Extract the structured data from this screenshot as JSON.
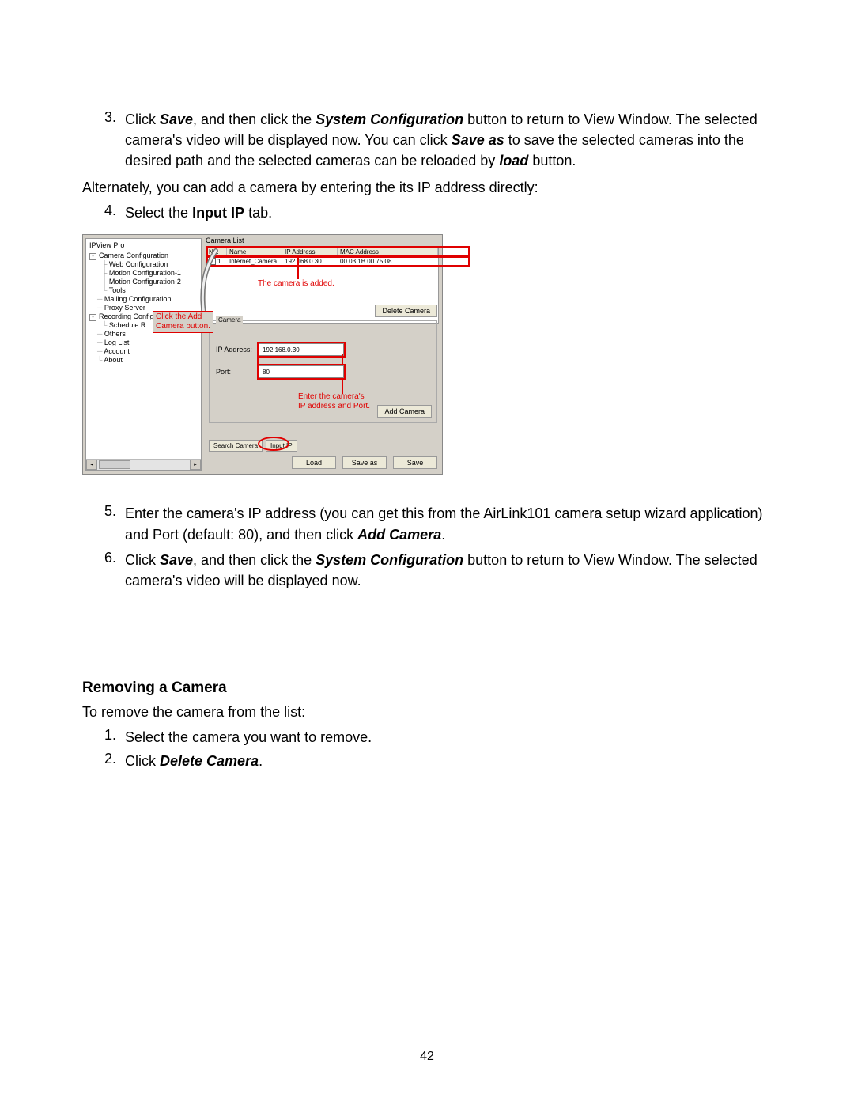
{
  "step3": {
    "num": "3.",
    "t1": "Click ",
    "save": "Save",
    "t2": ", and then click the ",
    "sysconf": "System Configuration",
    "t3": " button to return to View Window. The selected camera's video will be displayed now. You can click ",
    "saveas": "Save as",
    "t4": " to save the selected cameras into the desired path and the selected cameras can be reloaded by ",
    "load": "load",
    "t5": " button."
  },
  "alt_text": "Alternately, you can add a camera by entering the its IP address directly:",
  "step4": {
    "num": "4.",
    "t1": "Select the ",
    "inputip": "Input IP",
    "t2": " tab."
  },
  "app": {
    "title": "IPView Pro",
    "tree": {
      "cam_config": "Camera Configuration",
      "web_config": "Web Configuration",
      "motion1": "Motion Configuration-1",
      "motion2": "Motion Configuration-2",
      "tools": "Tools",
      "mailing": "Mailing Configuration",
      "proxy": "Proxy Server",
      "rec_config": "Recording Configuration",
      "schedule": "Schedule R",
      "others": "Others",
      "loglist": "Log List",
      "account": "Account",
      "about": "About"
    },
    "camera_list_label": "Camera List",
    "tbl": {
      "no": "No.",
      "name": "Name",
      "ip": "IP Address",
      "mac": "MAC Address"
    },
    "row": {
      "no": "1",
      "name": "Internet_Camera",
      "ip": "192.168.0.30",
      "mac": "00 03 1B 00 75 08"
    },
    "anno_added": "The camera is added.",
    "delete_btn": "Delete Camera",
    "anno_click_add1": "Click the Add",
    "anno_click_add2": "Camera button.",
    "add_group": "Camera",
    "ip_label": "IP Address:",
    "ip_value": "192.168.0.30",
    "port_label": "Port:",
    "port_value": "80",
    "anno_enter1": "Enter the camera's",
    "anno_enter2": "IP address and Port.",
    "add_btn": "Add Camera",
    "tab_search": "Search Camera",
    "tab_input": "Input IP",
    "btn_load": "Load",
    "btn_saveas": "Save as",
    "btn_save": "Save"
  },
  "step5": {
    "num": "5.",
    "t1": "Enter the camera's IP address (you can get this from the AirLink101 camera setup wizard application) and Port (default: 80), and then click ",
    "addcam": "Add Camera",
    "t2": "."
  },
  "step6": {
    "num": "6.",
    "t1": "Click ",
    "save": "Save",
    "t2": ", and then click the ",
    "sysconf": "System Configuration",
    "t3": " button to return to View Window. The selected camera's video will be displayed now."
  },
  "heading2": "Removing a Camera",
  "remove_intro": "To remove the camera from the list:",
  "r1": {
    "num": "1.",
    "t1": "Select the ",
    "cam": "camera",
    "t2": " you want to remove."
  },
  "r2": {
    "num": "2.",
    "t1": "Click ",
    "del": "Delete Camera",
    "t2": "."
  },
  "page": "42"
}
